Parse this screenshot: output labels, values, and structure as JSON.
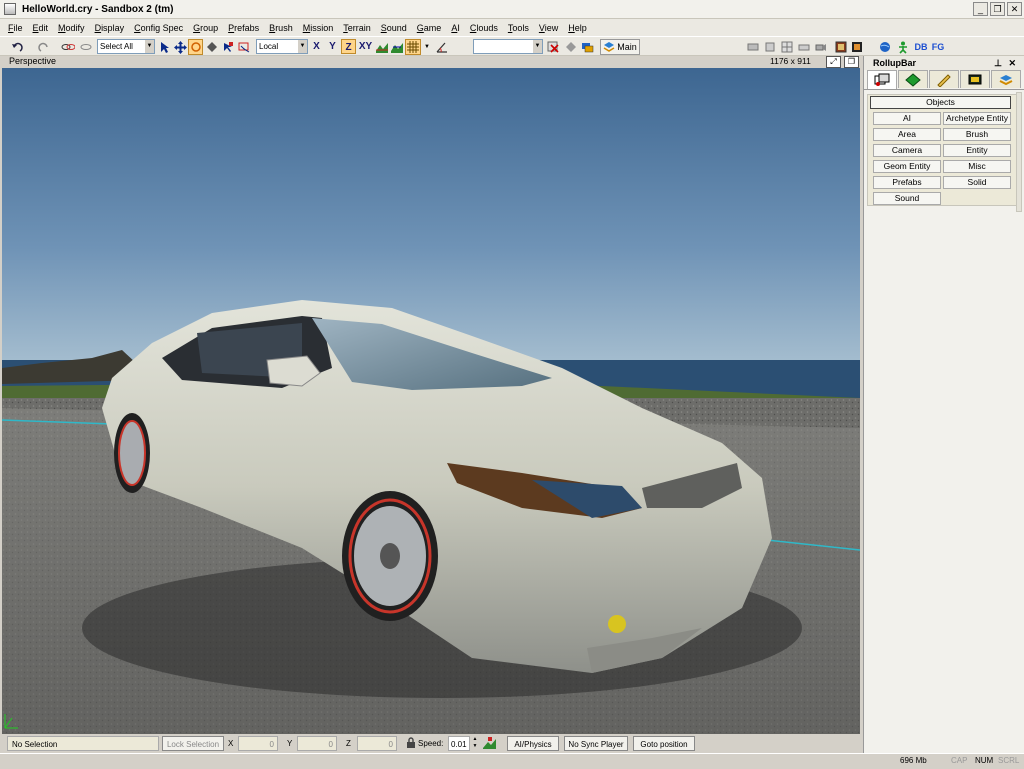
{
  "window": {
    "title": "HelloWorld.cry - Sandbox 2 (tm)",
    "buttons": [
      "_",
      "❐",
      "✕"
    ]
  },
  "menu": [
    "File",
    "Edit",
    "Modify",
    "Display",
    "Config Spec",
    "Group",
    "Prefabs",
    "Brush",
    "Mission",
    "Terrain",
    "Sound",
    "Game",
    "AI",
    "Clouds",
    "Tools",
    "View",
    "Help"
  ],
  "toolbar": {
    "selection_combo": "Select All",
    "coord_combo": "Local",
    "axes": [
      "X",
      "Y",
      "Z",
      "XY"
    ],
    "active_axis": "Z",
    "layer_label": "Main",
    "db_label": "DB",
    "fg_label": "FG"
  },
  "viewport": {
    "name": "Perspective",
    "resolution": "1176 x 911"
  },
  "rollup": {
    "title": "RollupBar",
    "objects_label": "Objects",
    "buttons": [
      "AI",
      "Archetype Entity",
      "Area",
      "Brush",
      "Camera",
      "Entity",
      "Geom Entity",
      "Misc",
      "Prefabs",
      "Solid",
      "Sound"
    ]
  },
  "status": {
    "selection": "No Selection",
    "lock_selection": "Lock Selection",
    "x_label": "X",
    "x_value": "0",
    "y_label": "Y",
    "y_value": "0",
    "z_label": "Z",
    "z_value": "0",
    "speed_label": "Speed:",
    "speed_value": "0.01",
    "ai_physics": "AI/Physics",
    "sync_player": "No Sync Player",
    "goto_position": "Goto position"
  },
  "bottom": {
    "memory": "696 Mb",
    "cap": "CAP",
    "num": "NUM",
    "scrl": "SCRL"
  },
  "colors": {
    "sky_top": "#3d6691",
    "sky_bottom": "#a7bfd0",
    "sea": "#2b4f73",
    "grass": "#4f6b33",
    "road": "#6a6a68",
    "car_body": "#c9cabd",
    "accent": "#ffd58a"
  }
}
